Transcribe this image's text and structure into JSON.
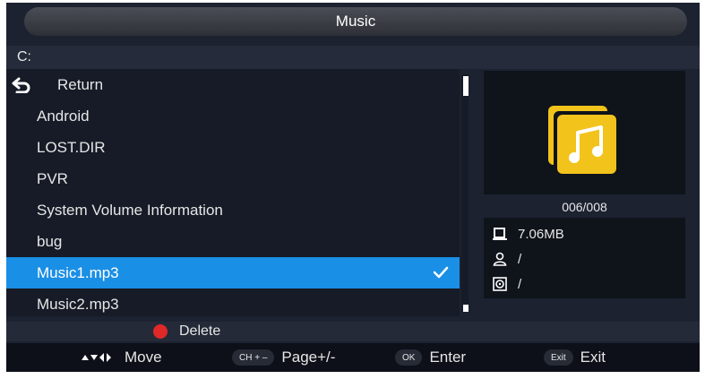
{
  "header": {
    "title": "Music"
  },
  "path": "C:",
  "file_list": [
    {
      "label": "Return",
      "type": "return"
    },
    {
      "label": "Android",
      "type": "folder"
    },
    {
      "label": "LOST.DIR",
      "type": "folder"
    },
    {
      "label": "PVR",
      "type": "folder"
    },
    {
      "label": "System Volume Information",
      "type": "folder"
    },
    {
      "label": "bug",
      "type": "folder"
    },
    {
      "label": "Music1.mp3",
      "type": "file",
      "selected": true
    },
    {
      "label": "Music2.mp3",
      "type": "file"
    }
  ],
  "preview": {
    "icon": "music-folder-icon",
    "counter": "006/008"
  },
  "info": {
    "size": "7.06MB",
    "artist": "/",
    "album": "/"
  },
  "delete_label": "Delete",
  "help_bar": {
    "move_label": "Move",
    "page_key": "CH + –",
    "page_label": "Page+/-",
    "ok_key": "OK",
    "enter_label": "Enter",
    "exit_key": "Exit",
    "exit_label": "Exit"
  },
  "colors": {
    "selection": "#1a8fe6",
    "accent_yellow": "#f2c31b",
    "delete_red": "#e02828"
  }
}
